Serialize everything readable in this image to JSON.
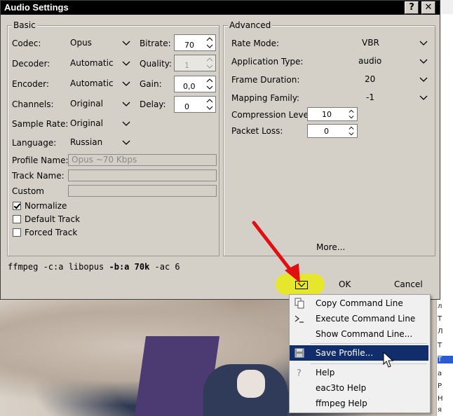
{
  "window": {
    "title": "Audio Settings",
    "help_label": "?",
    "close_label": "✕"
  },
  "basic": {
    "title": "Basic",
    "codec": {
      "label": "Codec:",
      "value": "Opus"
    },
    "decoder": {
      "label": "Decoder:",
      "value": "Automatic"
    },
    "encoder": {
      "label": "Encoder:",
      "value": "Automatic"
    },
    "channels": {
      "label": "Channels:",
      "value": "Original"
    },
    "sample_rate": {
      "label": "Sample Rate:",
      "value": "Original"
    },
    "language": {
      "label": "Language:",
      "value": "Russian"
    },
    "bitrate": {
      "label": "Bitrate:",
      "value": "70"
    },
    "quality": {
      "label": "Quality:",
      "value": "1"
    },
    "gain": {
      "label": "Gain:",
      "value": "0,0"
    },
    "delay": {
      "label": "Delay:",
      "value": "0"
    },
    "profile_name": {
      "label": "Profile Name:",
      "value": "Opus ~70 Kbps"
    },
    "track_name": {
      "label": "Track Name:",
      "value": ""
    },
    "custom": {
      "label": "Custom",
      "value": ""
    },
    "normalize": {
      "label": "Normalize",
      "checked": true
    },
    "default_track": {
      "label": "Default Track",
      "checked": false
    },
    "forced_track": {
      "label": "Forced Track",
      "checked": false
    }
  },
  "advanced": {
    "title": "Advanced",
    "rate_mode": {
      "label": "Rate Mode:",
      "value": "VBR"
    },
    "application_type": {
      "label": "Application Type:",
      "value": "audio"
    },
    "frame_duration": {
      "label": "Frame Duration:",
      "value": "20"
    },
    "mapping_family": {
      "label": "Mapping Family:",
      "value": "-1"
    },
    "compression_level": {
      "label": "Compression Level:",
      "value": "10"
    },
    "packet_loss": {
      "label": "Packet Loss:",
      "value": "0"
    },
    "more_label": "More..."
  },
  "command_line": {
    "prefix": "ffmpeg -c:a libopus ",
    "flag_b": "-b:a 70k",
    "suffix": " -ac 6"
  },
  "buttons": {
    "ok": "OK",
    "cancel": "Cancel"
  },
  "context_menu": {
    "items": [
      {
        "label": "Copy Command Line",
        "icon": "copy-icon"
      },
      {
        "label": "Execute Command Line",
        "icon": "terminal-icon"
      },
      {
        "label": "Show Command Line...",
        "icon": ""
      },
      {
        "label": "Save Profile...",
        "icon": "save-icon",
        "highlighted": true
      },
      {
        "label": "Help",
        "icon": "help-icon"
      },
      {
        "label": "eac3to Help",
        "icon": ""
      },
      {
        "label": "ffmpeg Help",
        "icon": ""
      }
    ]
  },
  "background_list": [
    "л",
    "T",
    "Л",
    "T",
    "T",
    "a",
    "P",
    "H",
    "я"
  ],
  "colors": {
    "highlight": "#e6e62c",
    "menu_selection": "#122d6b",
    "annotation_arrow": "#e01010"
  }
}
